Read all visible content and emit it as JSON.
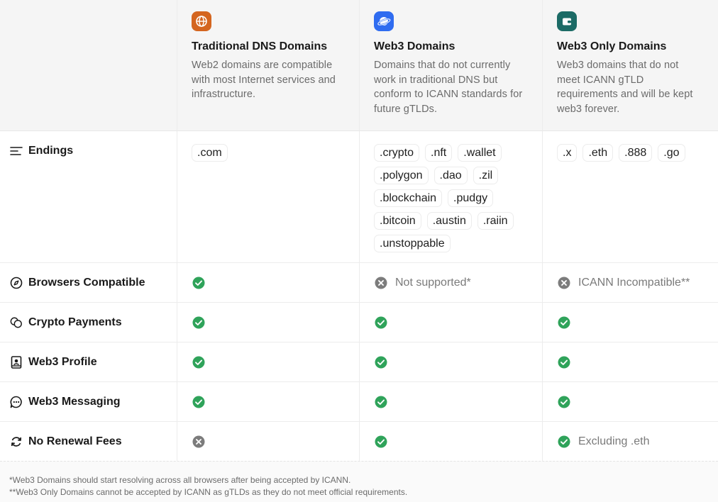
{
  "columns": [
    {
      "title": "Traditional DNS Domains",
      "description": "Web2 domains are compatible with most Internet services and infrastructure.",
      "icon": "globe-icon",
      "color": "#d4651f"
    },
    {
      "title": "Web3 Domains",
      "description": "Domains that do not currently work in traditional DNS but conform to ICANN standards for future gTLDs.",
      "icon": "planet-icon",
      "color": "#2f6cf0"
    },
    {
      "title": "Web3 Only Domains",
      "description": "Web3 domains that do not meet ICANN gTLD requirements and will be kept web3 forever.",
      "icon": "wallet-icon",
      "color": "#1c6b66"
    }
  ],
  "endings": {
    "label": "Endings",
    "col1": [
      ".com"
    ],
    "col2": [
      ".crypto",
      ".nft",
      ".wallet",
      ".polygon",
      ".dao",
      ".zil",
      ".blockchain",
      ".pudgy",
      ".bitcoin",
      ".austin",
      ".raiin",
      ".unstoppable"
    ],
    "col3": [
      ".x",
      ".eth",
      ".888",
      ".go"
    ]
  },
  "features": [
    {
      "label": "Browsers Compatible",
      "icon": "compass-icon",
      "cells": [
        {
          "status": "check",
          "note": ""
        },
        {
          "status": "cross",
          "note": "Not supported*"
        },
        {
          "status": "cross",
          "note": "ICANN Incompatible**"
        }
      ]
    },
    {
      "label": "Crypto Payments",
      "icon": "coins-icon",
      "cells": [
        {
          "status": "check",
          "note": ""
        },
        {
          "status": "check",
          "note": ""
        },
        {
          "status": "check",
          "note": ""
        }
      ]
    },
    {
      "label": "Web3 Profile",
      "icon": "profile-book-icon",
      "cells": [
        {
          "status": "check",
          "note": ""
        },
        {
          "status": "check",
          "note": ""
        },
        {
          "status": "check",
          "note": ""
        }
      ]
    },
    {
      "label": "Web3 Messaging",
      "icon": "chat-bubble-icon",
      "cells": [
        {
          "status": "check",
          "note": ""
        },
        {
          "status": "check",
          "note": ""
        },
        {
          "status": "check",
          "note": ""
        }
      ]
    },
    {
      "label": "No Renewal Fees",
      "icon": "refresh-icon",
      "cells": [
        {
          "status": "cross",
          "note": ""
        },
        {
          "status": "check",
          "note": ""
        },
        {
          "status": "check",
          "note": "Excluding .eth"
        }
      ]
    }
  ],
  "footnotes": [
    "*Web3 Domains should start resolving across all browsers after being accepted by ICANN.",
    "**Web3 Only Domains cannot be accepted by ICANN as gTLDs as they do not meet official requirements."
  ],
  "colors": {
    "check": "#2fa35a",
    "cross": "#7c7c7c"
  }
}
